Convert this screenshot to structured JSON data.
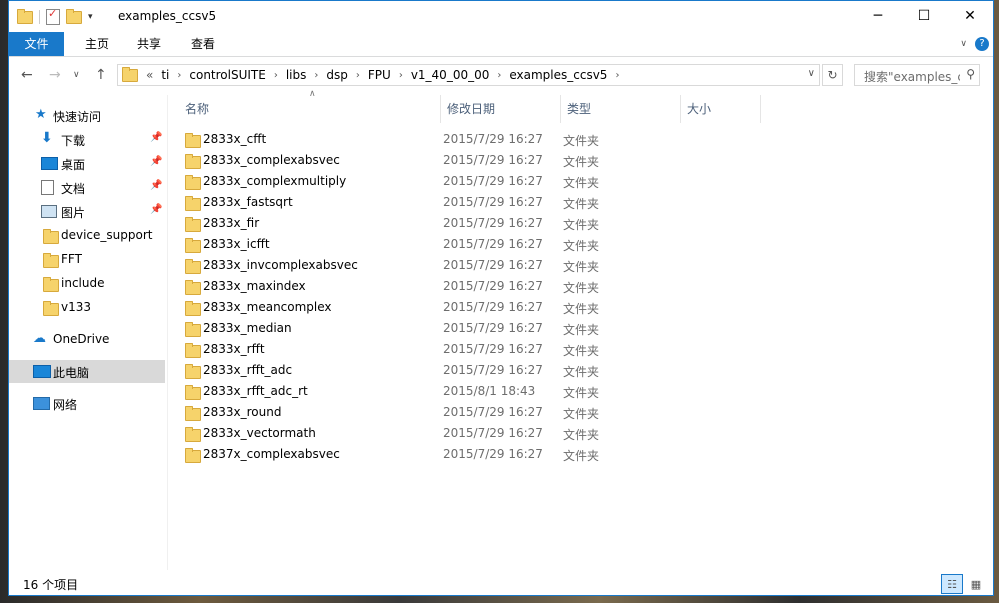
{
  "window": {
    "title": "examples_ccsv5",
    "controls": {
      "minimize": "─",
      "maximize": "☐",
      "close": "✕"
    }
  },
  "ribbon": {
    "tabs": [
      "文件",
      "主页",
      "共享",
      "查看"
    ],
    "accent": "#1979ca"
  },
  "address": {
    "overflow": "«",
    "breadcrumbs": [
      "ti",
      "controlSUITE",
      "libs",
      "dsp",
      "FPU",
      "v1_40_00_00",
      "examples_ccsv5"
    ]
  },
  "search": {
    "placeholder": "搜索\"examples_ccsv5\""
  },
  "sidebar": {
    "quick_access": "快速访问",
    "pinned": [
      {
        "label": "下载",
        "icon": "download-icon"
      },
      {
        "label": "桌面",
        "icon": "desktop-icon"
      },
      {
        "label": "文档",
        "icon": "document-icon"
      },
      {
        "label": "图片",
        "icon": "pictures-icon"
      }
    ],
    "recent": [
      "device_support",
      "FFT",
      "include",
      "v133"
    ],
    "onedrive": "OneDrive",
    "this_pc": "此电脑",
    "network": "网络"
  },
  "columns": {
    "name": "名称",
    "modified": "修改日期",
    "type": "类型",
    "size": "大小"
  },
  "files": [
    {
      "name": "2833x_cfft",
      "modified": "2015/7/29 16:27",
      "type": "文件夹"
    },
    {
      "name": "2833x_complexabsvec",
      "modified": "2015/7/29 16:27",
      "type": "文件夹"
    },
    {
      "name": "2833x_complexmultiply",
      "modified": "2015/7/29 16:27",
      "type": "文件夹"
    },
    {
      "name": "2833x_fastsqrt",
      "modified": "2015/7/29 16:27",
      "type": "文件夹"
    },
    {
      "name": "2833x_fir",
      "modified": "2015/7/29 16:27",
      "type": "文件夹"
    },
    {
      "name": "2833x_icfft",
      "modified": "2015/7/29 16:27",
      "type": "文件夹"
    },
    {
      "name": "2833x_invcomplexabsvec",
      "modified": "2015/7/29 16:27",
      "type": "文件夹"
    },
    {
      "name": "2833x_maxindex",
      "modified": "2015/7/29 16:27",
      "type": "文件夹"
    },
    {
      "name": "2833x_meancomplex",
      "modified": "2015/7/29 16:27",
      "type": "文件夹"
    },
    {
      "name": "2833x_median",
      "modified": "2015/7/29 16:27",
      "type": "文件夹"
    },
    {
      "name": "2833x_rfft",
      "modified": "2015/7/29 16:27",
      "type": "文件夹"
    },
    {
      "name": "2833x_rfft_adc",
      "modified": "2015/7/29 16:27",
      "type": "文件夹"
    },
    {
      "name": "2833x_rfft_adc_rt",
      "modified": "2015/8/1 18:43",
      "type": "文件夹"
    },
    {
      "name": "2833x_round",
      "modified": "2015/7/29 16:27",
      "type": "文件夹"
    },
    {
      "name": "2833x_vectormath",
      "modified": "2015/7/29 16:27",
      "type": "文件夹"
    },
    {
      "name": "2837x_complexabsvec",
      "modified": "2015/7/29 16:27",
      "type": "文件夹"
    }
  ],
  "status": {
    "item_count": "16 个项目"
  }
}
